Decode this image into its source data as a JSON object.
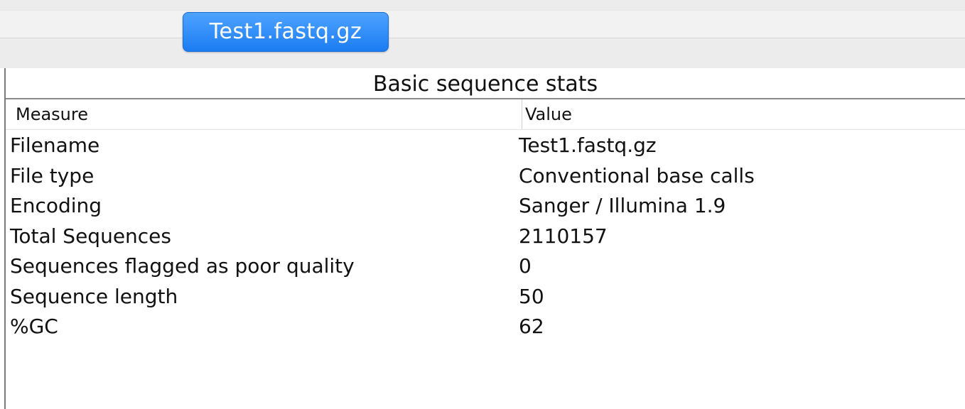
{
  "tab": {
    "label": "Test1.fastq.gz"
  },
  "panel": {
    "title": "Basic sequence stats"
  },
  "table": {
    "columns": [
      "Measure",
      "Value"
    ],
    "rows": [
      {
        "measure": "Filename",
        "value": "Test1.fastq.gz"
      },
      {
        "measure": "File type",
        "value": "Conventional base calls"
      },
      {
        "measure": "Encoding",
        "value": "Sanger / Illumina 1.9"
      },
      {
        "measure": "Total Sequences",
        "value": "2110157"
      },
      {
        "measure": "Sequences flagged as poor quality",
        "value": "0"
      },
      {
        "measure": "Sequence length",
        "value": "50"
      },
      {
        "measure": "%GC",
        "value": "62"
      }
    ]
  },
  "colors": {
    "tab_accent": "#1b7cf2",
    "background": "#ffffff",
    "toolbar": "#ececec"
  }
}
